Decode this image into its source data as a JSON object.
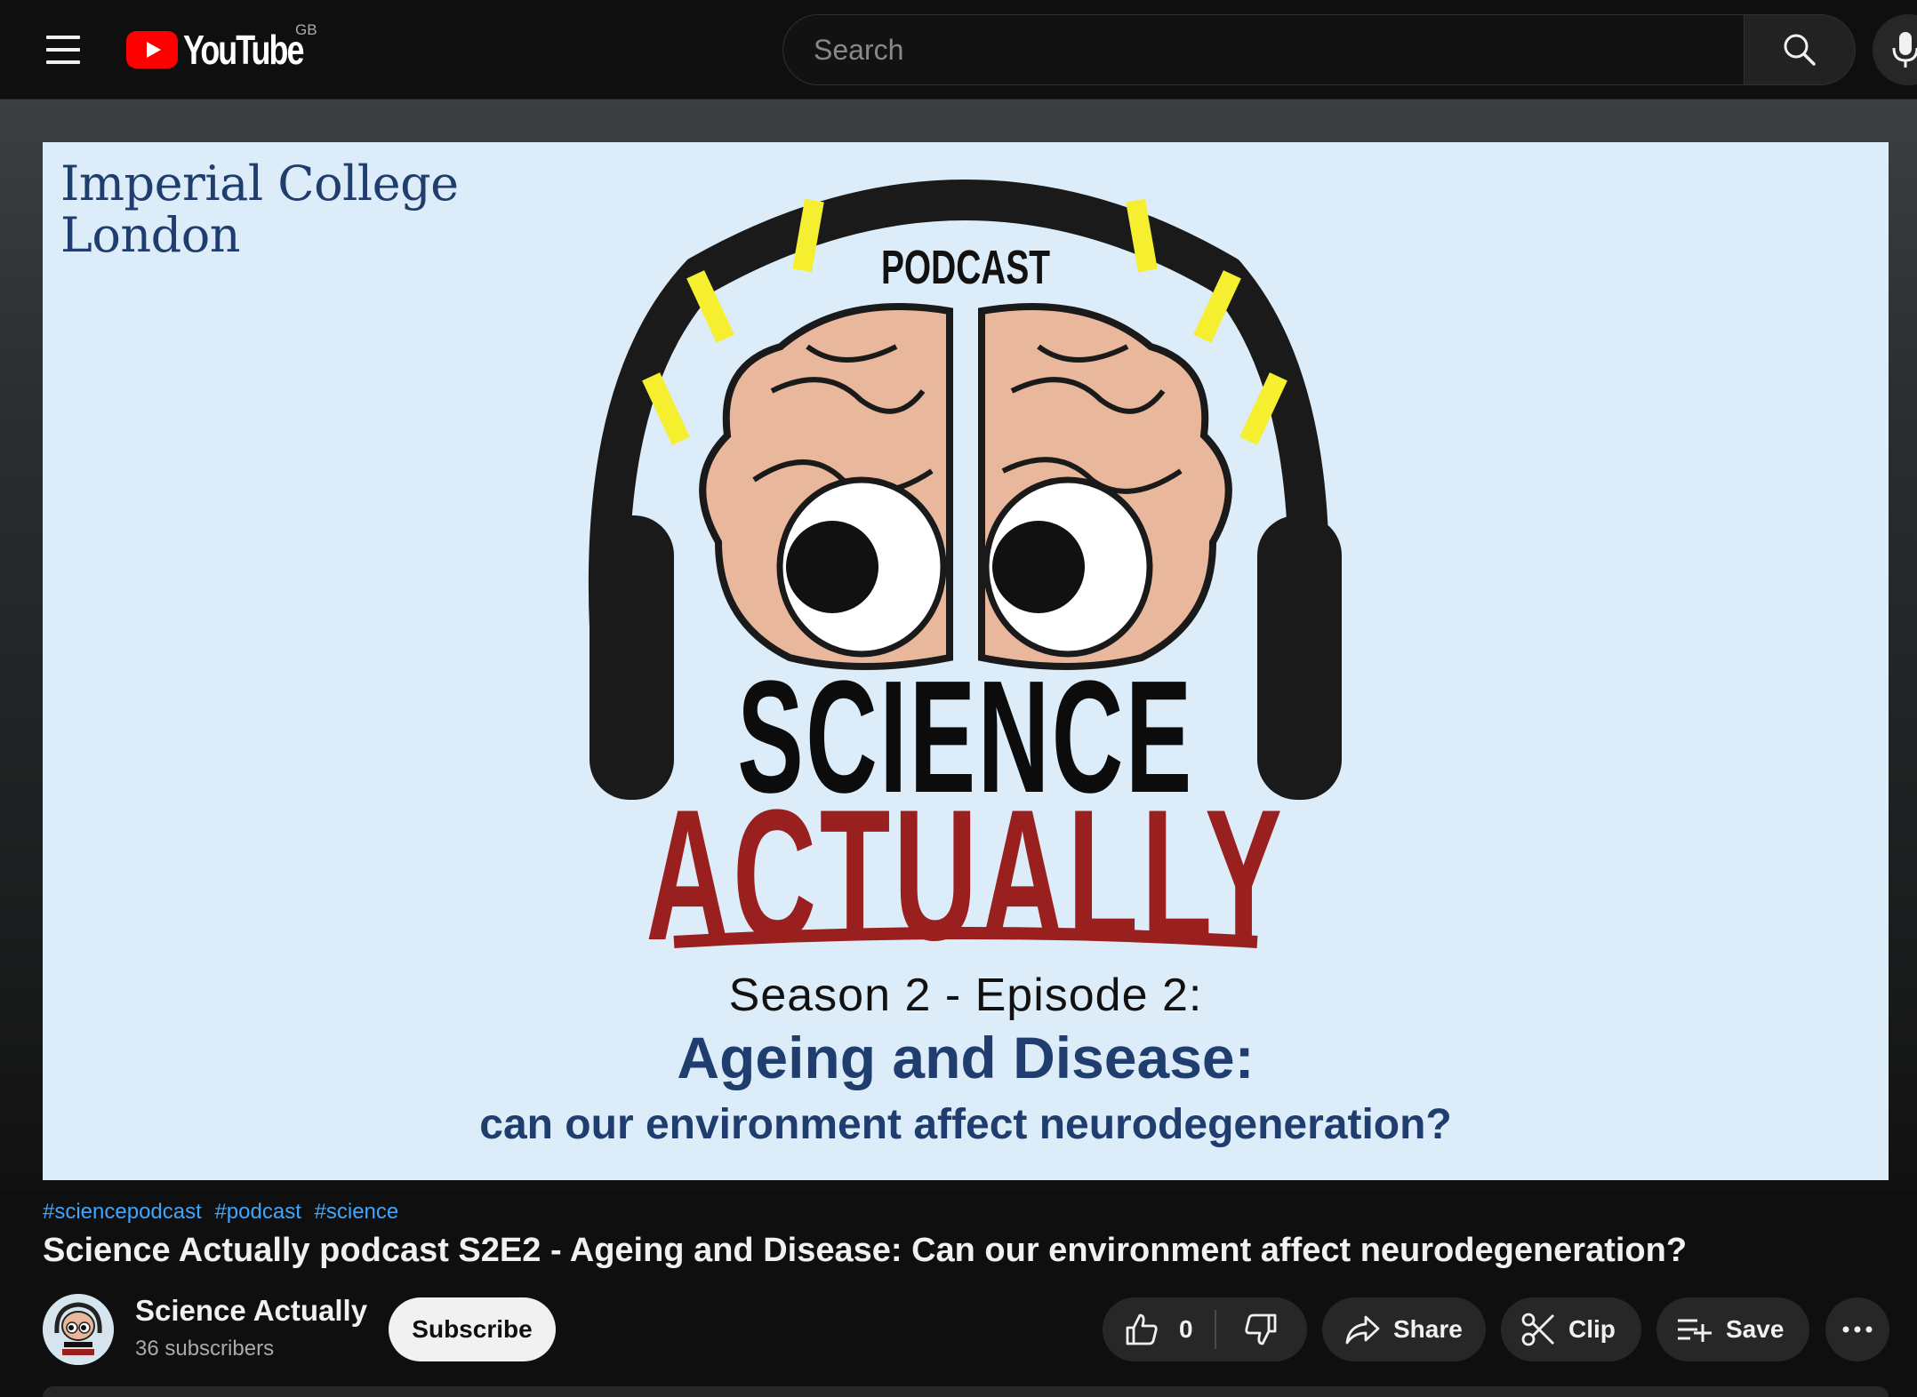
{
  "header": {
    "logo_text": "YouTube",
    "country_code": "GB",
    "search_placeholder": "Search"
  },
  "video": {
    "thumbnail": {
      "institution": [
        "Imperial College",
        "London"
      ],
      "podcast_label": "PODCAST",
      "show_name_line1": "SCIENCE",
      "show_name_line2": "ACTUALLY",
      "season_episode": "Season 2 - Episode 2:",
      "episode_title": "Ageing and Disease:",
      "episode_subtitle": "can our environment affect neurodegeneration?"
    },
    "hashtags": [
      "#sciencepodcast",
      "#podcast",
      "#science"
    ],
    "title": "Science Actually podcast S2E2 - Ageing and Disease: Can our environment affect neurodegeneration?"
  },
  "channel": {
    "name": "Science Actually",
    "subscribers": "36 subscribers",
    "subscribe_label": "Subscribe"
  },
  "actions": {
    "like_count": "0",
    "share_label": "Share",
    "clip_label": "Clip",
    "save_label": "Save"
  },
  "colors": {
    "brand_red": "#ff0000",
    "link_blue": "#3ea6ff",
    "thumbnail_bg": "#dcecf8",
    "actually_red": "#9a1f1f",
    "imperial_blue": "#1f3d6e"
  }
}
